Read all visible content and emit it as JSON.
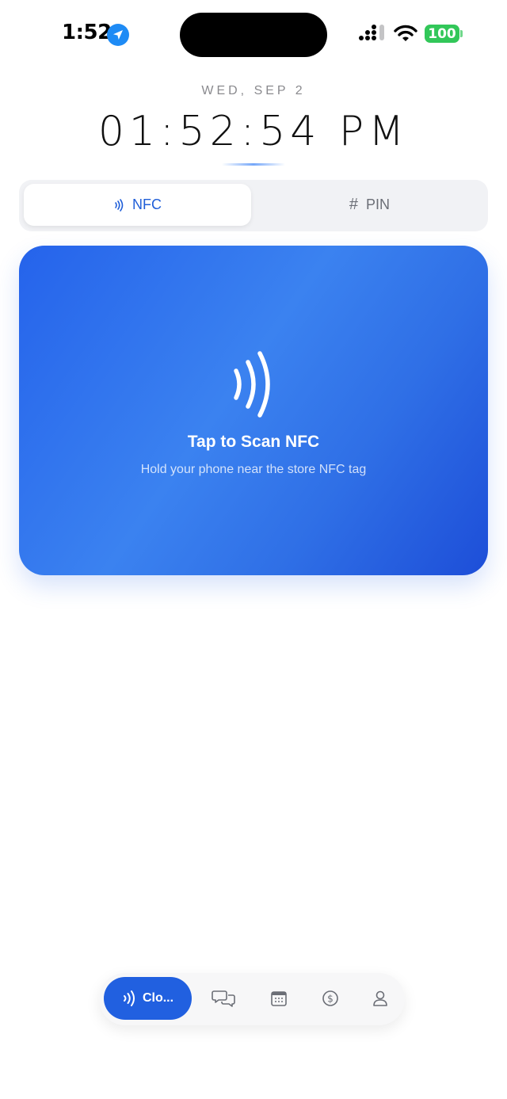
{
  "status_bar": {
    "time": "1:52",
    "battery": "100"
  },
  "clock": {
    "date": "WED, SEP 2",
    "time": "01:52:54 PM"
  },
  "segmented": {
    "nfc_label": "NFC",
    "pin_label": "PIN",
    "pin_icon": "#",
    "active": "NFC"
  },
  "nfc_card": {
    "title": "Tap to Scan NFC",
    "subtitle": "Hold your phone near the store NFC tag"
  },
  "tab_bar": {
    "active_label": "Clo...",
    "tabs": [
      "nfc-waves-icon",
      "chat-bubbles-icon",
      "calendar-icon",
      "dollar-icon",
      "person-icon"
    ]
  },
  "colors": {
    "accent": "#2160e0",
    "battery": "#32c759",
    "location": "#1e8bf5"
  }
}
